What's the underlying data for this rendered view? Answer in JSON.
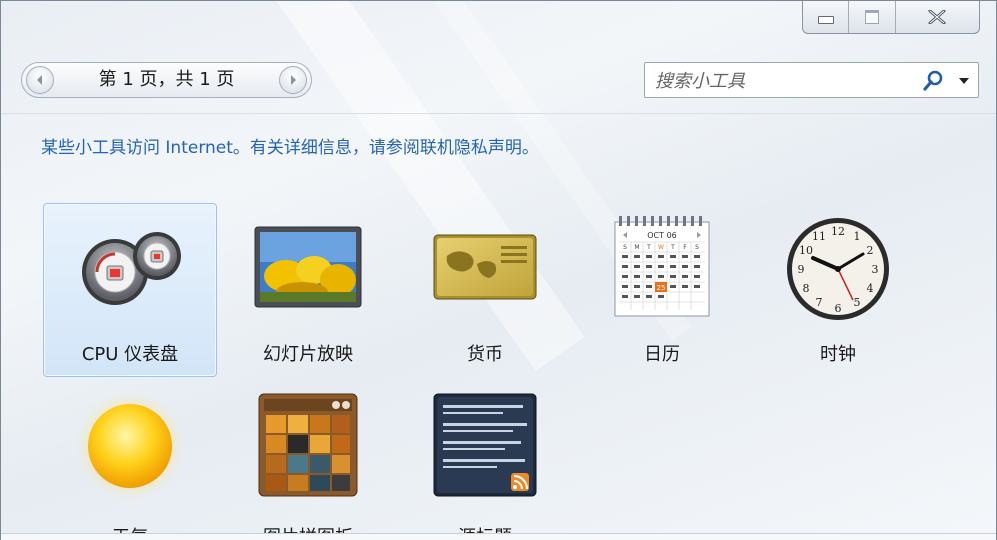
{
  "window": {
    "caption": {
      "min_label": "",
      "max_label": "",
      "close_label": ""
    }
  },
  "pager": {
    "text": "第 1 页，共 1 页"
  },
  "search": {
    "placeholder": "搜索小工具",
    "value": ""
  },
  "notice": {
    "text": "某些小工具访问 Internet。有关详细信息，请参阅联机隐私声明。"
  },
  "gadgets": [
    {
      "label": "CPU 仪表盘",
      "icon": "cpu-meter-icon",
      "selected": true
    },
    {
      "label": "幻灯片放映",
      "icon": "slideshow-icon",
      "selected": false
    },
    {
      "label": "货币",
      "icon": "currency-icon",
      "selected": false
    },
    {
      "label": "日历",
      "icon": "calendar-icon",
      "selected": false
    },
    {
      "label": "时钟",
      "icon": "clock-icon",
      "selected": false
    },
    {
      "label": "天气",
      "icon": "weather-icon",
      "selected": false
    },
    {
      "label": "图片拼图板",
      "icon": "picture-puzzle-icon",
      "selected": false
    },
    {
      "label": "源标题",
      "icon": "feed-headlines-icon",
      "selected": false
    }
  ],
  "calendar": {
    "month": "OCT 06",
    "highlight_day": "25"
  },
  "colors": {
    "accent_link": "#2464b4",
    "selection_border": "#9cc4ea",
    "selection_fill": "#d2e5f8"
  }
}
